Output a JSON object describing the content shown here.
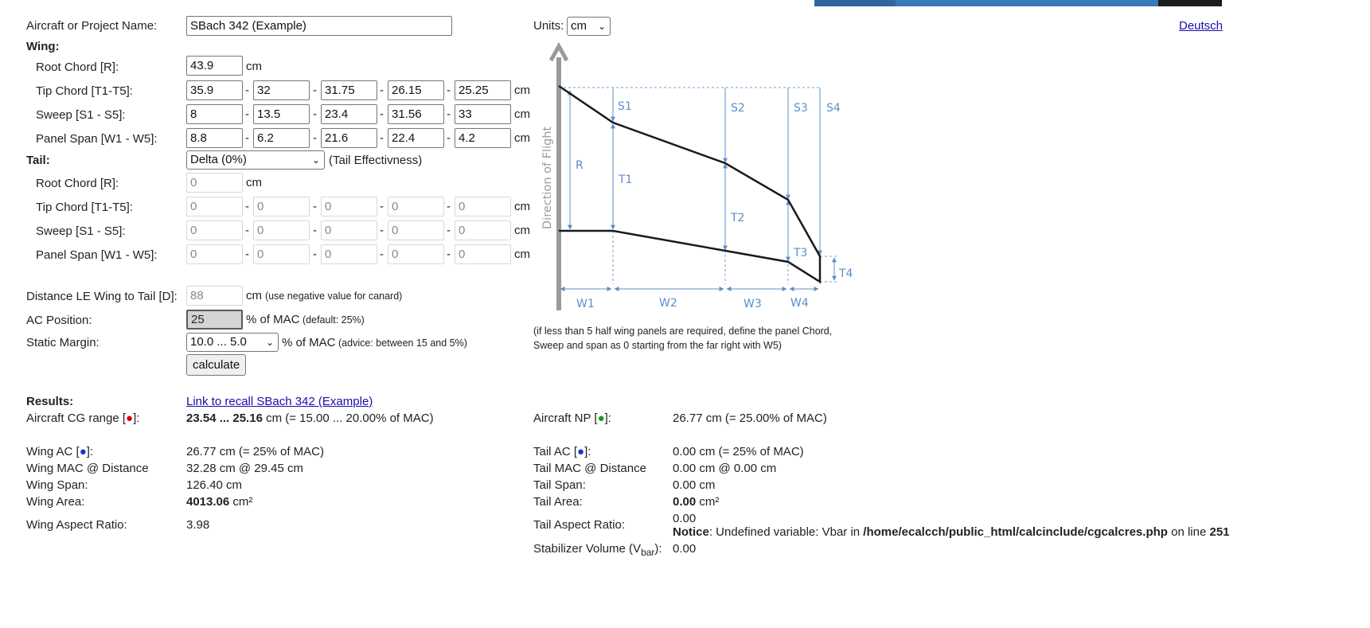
{
  "form": {
    "project_label": "Aircraft or Project Name:",
    "project_value": "SBach 342 (Example)",
    "units_label": "Units:",
    "units_value": "cm",
    "language_link": "Deutsch"
  },
  "wing": {
    "heading": "Wing:",
    "root_chord_label": "Root Chord [R]:",
    "root_chord_value": "43.9",
    "tip_chord_label": "Tip Chord [T1-T5]:",
    "tip_chord_values": [
      "35.9",
      "32",
      "31.75",
      "26.15",
      "25.25"
    ],
    "sweep_label": "Sweep [S1 - S5]:",
    "sweep_values": [
      "8",
      "13.5",
      "23.4",
      "31.56",
      "33"
    ],
    "span_label": "Panel Span [W1 - W5]:",
    "span_values": [
      "8.8",
      "6.2",
      "21.6",
      "22.4",
      "4.2"
    ]
  },
  "tail": {
    "heading": "Tail:",
    "type_value": "Delta (0%)",
    "effectiveness_label": "(Tail Effectivness)",
    "root_chord_label": "Root Chord [R]:",
    "root_chord_value": "0",
    "tip_chord_label": "Tip Chord [T1-T5]:",
    "tip_chord_values": [
      "0",
      "0",
      "0",
      "0",
      "0"
    ],
    "sweep_label": "Sweep [S1 - S5]:",
    "sweep_values": [
      "0",
      "0",
      "0",
      "0",
      "0"
    ],
    "span_label": "Panel Span [W1 - W5]:",
    "span_values": [
      "0",
      "0",
      "0",
      "0",
      "0"
    ]
  },
  "units": {
    "cm": "cm",
    "dash": "-"
  },
  "distance": {
    "label": "Distance LE Wing to Tail [D]:",
    "value": "88",
    "unit": "cm",
    "note": "(use negative value for canard)"
  },
  "ac_position": {
    "label": "AC Position:",
    "value": "25",
    "unit": "% of MAC",
    "note": "(default: 25%)"
  },
  "static_margin": {
    "label": "Static Margin:",
    "value": "10.0 ... 5.0",
    "unit": "% of MAC",
    "note": "(advice: between 15 and 5%)"
  },
  "calculate_button": "calculate",
  "diagram": {
    "direction_label": "Direction of Flight",
    "labels": [
      "S1",
      "S2",
      "S3",
      "S4",
      "R",
      "T1",
      "T2",
      "T3",
      "T4",
      "W1",
      "W2",
      "W3",
      "W4"
    ],
    "note_line1": "(if less than 5 half wing panels are required, define the panel Chord,",
    "note_line2": "Sweep and span as 0 starting from the far right with W5)"
  },
  "results": {
    "heading": "Results:",
    "recall_link": "Link to recall SBach 342 (Example)",
    "cg_label_pre": "Aircraft CG range [",
    "cg_label_post": "]:",
    "cg_value_bold": "23.54 ... 25.16",
    "cg_value_rest": " cm (= 15.00 ... 20.00% of MAC)",
    "np_label_pre": "Aircraft NP [",
    "np_label_post": "]:",
    "np_value": "26.77 cm (= 25.00% of MAC)",
    "dot": "●",
    "wing_ac_label_pre": "Wing AC [",
    "wing_ac_label_post": "]:",
    "wing_ac_value": "26.77 cm (= 25% of MAC)",
    "wing_mac_label": "Wing MAC @ Distance",
    "wing_mac_value": "32.28 cm @ 29.45 cm",
    "wing_span_label": "Wing Span:",
    "wing_span_value": "126.40 cm",
    "wing_area_label": "Wing Area:",
    "wing_area_bold": "4013.06",
    "wing_area_unit": " cm²",
    "wing_ar_label": "Wing Aspect Ratio:",
    "wing_ar_value": "3.98",
    "tail_ac_label_pre": "Tail AC [",
    "tail_ac_label_post": "]:",
    "tail_ac_value": "0.00 cm (= 25% of MAC)",
    "tail_mac_label": "Tail MAC @ Distance",
    "tail_mac_value": "0.00 cm @ 0.00 cm",
    "tail_span_label": "Tail Span:",
    "tail_span_value": "0.00 cm",
    "tail_area_label": "Tail Area:",
    "tail_area_bold": "0.00",
    "tail_area_unit": " cm²",
    "tail_ar_label": "Tail Aspect Ratio:",
    "tail_ar_value": "0.00",
    "notice_bold": "Notice",
    "notice_text": ": Undefined variable: Vbar in ",
    "notice_path": "/home/ecalcch/public_html/calcinclude/cgcalcres.php",
    "notice_on_line": " on line ",
    "notice_line": "251",
    "stab_label_pre": "Stabilizer Volume (V",
    "stab_label_sub": "bar",
    "stab_label_post": "):",
    "stab_value": "0.00"
  }
}
